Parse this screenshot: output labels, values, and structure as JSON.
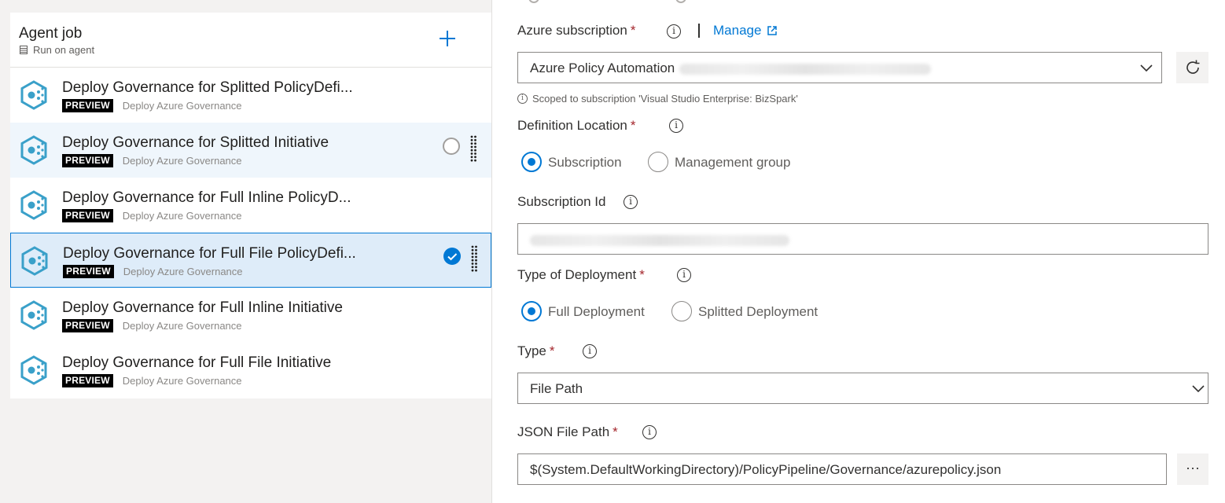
{
  "agent_job": {
    "title": "Agent job",
    "subtitle": "Run on agent",
    "add_icon": "plus-icon"
  },
  "tasks": [
    {
      "name": "Deploy Governance for Splitted PolicyDefi...",
      "badge": "PREVIEW",
      "subtitle": "Deploy Azure Governance",
      "state": "normal"
    },
    {
      "name": "Deploy Governance for Splitted Initiative",
      "badge": "PREVIEW",
      "subtitle": "Deploy Azure Governance",
      "state": "hover"
    },
    {
      "name": "Deploy Governance for Full Inline PolicyD...",
      "badge": "PREVIEW",
      "subtitle": "Deploy Azure Governance",
      "state": "normal"
    },
    {
      "name": "Deploy Governance for Full File PolicyDefi...",
      "badge": "PREVIEW",
      "subtitle": "Deploy Azure Governance",
      "state": "selected"
    },
    {
      "name": "Deploy Governance for Full Inline Initiative",
      "badge": "PREVIEW",
      "subtitle": "Deploy Azure Governance",
      "state": "normal"
    },
    {
      "name": "Deploy Governance for Full File Initiative",
      "badge": "PREVIEW",
      "subtitle": "Deploy Azure Governance",
      "state": "normal"
    }
  ],
  "form": {
    "azure_subscription": {
      "label": "Azure subscription",
      "required": "*",
      "manage_label": "Manage",
      "value": "Azure Policy Automation",
      "hint": "Scoped to subscription 'Visual Studio Enterprise: BizSpark'"
    },
    "definition_location": {
      "label": "Definition Location",
      "required": "*",
      "options": [
        "Subscription",
        "Management group"
      ],
      "selected": "Subscription"
    },
    "subscription_id": {
      "label": "Subscription Id",
      "value": ""
    },
    "type_of_deployment": {
      "label": "Type of Deployment",
      "required": "*",
      "options": [
        "Full Deployment",
        "Splitted Deployment"
      ],
      "selected": "Full Deployment"
    },
    "type": {
      "label": "Type",
      "required": "*",
      "value": "File Path"
    },
    "json_file_path": {
      "label": "JSON File Path",
      "required": "*",
      "value": "$(System.DefaultWorkingDirectory)/PolicyPipeline/Governance/azurepolicy.json",
      "browse_label": "···"
    }
  },
  "colors": {
    "accent": "#0078d4",
    "required": "#a4262c",
    "selected_bg": "#deecf9",
    "hover_bg": "#eff6fc"
  }
}
